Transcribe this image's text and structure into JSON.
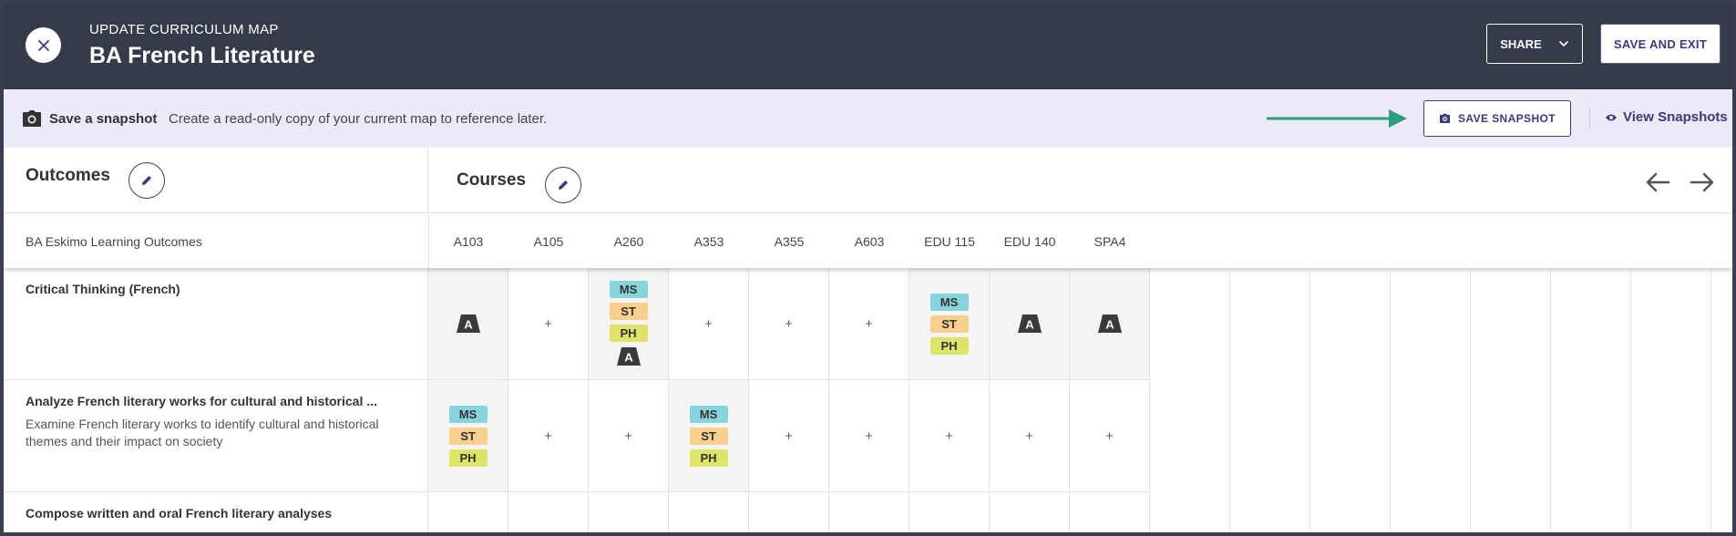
{
  "header": {
    "subtitle": "UPDATE CURRICULUM MAP",
    "title": "BA French Literature",
    "share_label": "SHARE",
    "save_exit_label": "SAVE AND EXIT"
  },
  "snapshot_bar": {
    "label": "Save a snapshot",
    "description": "Create a read-only copy of your current map to reference later.",
    "save_button_label": "SAVE SNAPSHOT",
    "view_link_label": "View Snapshots",
    "annotation_arrow_color": "#2e9e7a"
  },
  "outcomes": {
    "title": "Outcomes",
    "set_label": "BA Eskimo Learning Outcomes"
  },
  "courses": {
    "title": "Courses",
    "columns": [
      "A103",
      "A105",
      "A260",
      "A353",
      "A355",
      "A603",
      "EDU 115",
      "EDU 140",
      "SPA4"
    ]
  },
  "tag_labels": {
    "ms": "MS",
    "st": "ST",
    "ph": "PH",
    "a": "A"
  },
  "rows": [
    {
      "title": "Critical Thinking (French)",
      "description": "",
      "cells": [
        [
          "A"
        ],
        [],
        [
          "MS",
          "ST",
          "PH",
          "A"
        ],
        [],
        [],
        [],
        [
          "MS",
          "ST",
          "PH"
        ],
        [
          "A"
        ],
        [
          "A"
        ]
      ]
    },
    {
      "title": "Analyze French literary works for cultural and historical ...",
      "description": "Examine French literary works to identify cultural and historical themes and their impact on society",
      "cells": [
        [
          "MS",
          "ST",
          "PH"
        ],
        [],
        [],
        [
          "MS",
          "ST",
          "PH"
        ],
        [],
        [],
        [],
        [],
        []
      ]
    },
    {
      "title": "Compose written and oral French literary analyses",
      "description": "",
      "cells": [
        [],
        [],
        [],
        [],
        [],
        [],
        [],
        [],
        []
      ]
    }
  ],
  "colors": {
    "header_bg": "#363b4a",
    "snapshot_bar_bg": "#eceaf6",
    "accent": "#3b3a7a",
    "tag_ms": "#86d4dc",
    "tag_st": "#f9cf8e",
    "tag_ph": "#dfe36a"
  }
}
